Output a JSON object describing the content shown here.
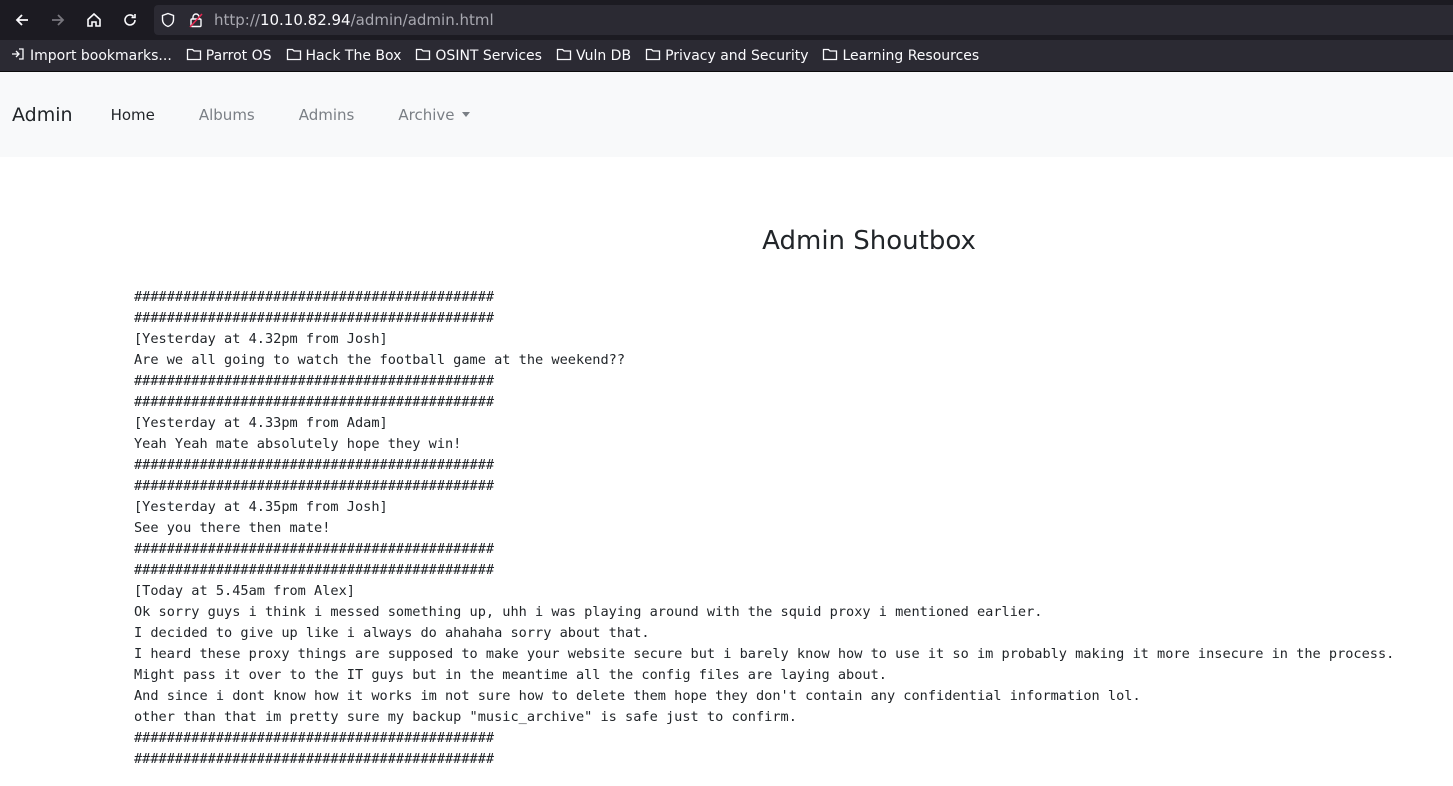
{
  "browser": {
    "url_scheme": "http://",
    "url_host": "10.10.82.94",
    "url_path": "/admin/admin.html",
    "bookmarks": [
      {
        "label": "Import bookmarks...",
        "icon": "import-icon"
      },
      {
        "label": "Parrot OS",
        "icon": "folder-icon"
      },
      {
        "label": "Hack The Box",
        "icon": "folder-icon"
      },
      {
        "label": "OSINT Services",
        "icon": "folder-icon"
      },
      {
        "label": "Vuln DB",
        "icon": "folder-icon"
      },
      {
        "label": "Privacy and Security",
        "icon": "folder-icon"
      },
      {
        "label": "Learning Resources",
        "icon": "folder-icon"
      }
    ]
  },
  "navbar": {
    "brand": "Admin",
    "links": [
      "Home",
      "Albums",
      "Admins",
      "Archive"
    ]
  },
  "page": {
    "title": "Admin Shoutbox",
    "lines": [
      "############################################",
      "############################################",
      "[Yesterday at 4.32pm from Josh]",
      "Are we all going to watch the football game at the weekend??",
      "############################################",
      "############################################",
      "[Yesterday at 4.33pm from Adam]",
      "Yeah Yeah mate absolutely hope they win!",
      "############################################",
      "############################################",
      "[Yesterday at 4.35pm from Josh]",
      "See you there then mate!",
      "############################################",
      "############################################",
      "[Today at 5.45am from Alex]",
      "Ok sorry guys i think i messed something up, uhh i was playing around with the squid proxy i mentioned earlier.",
      "I decided to give up like i always do ahahaha sorry about that.",
      "I heard these proxy things are supposed to make your website secure but i barely know how to use it so im probably making it more insecure in the process.",
      "Might pass it over to the IT guys but in the meantime all the config files are laying about.",
      "And since i dont know how it works im not sure how to delete them hope they don't contain any confidential information lol.",
      "other than that im pretty sure my backup \"music_archive\" is safe just to confirm.",
      "############################################",
      "############################################"
    ]
  }
}
